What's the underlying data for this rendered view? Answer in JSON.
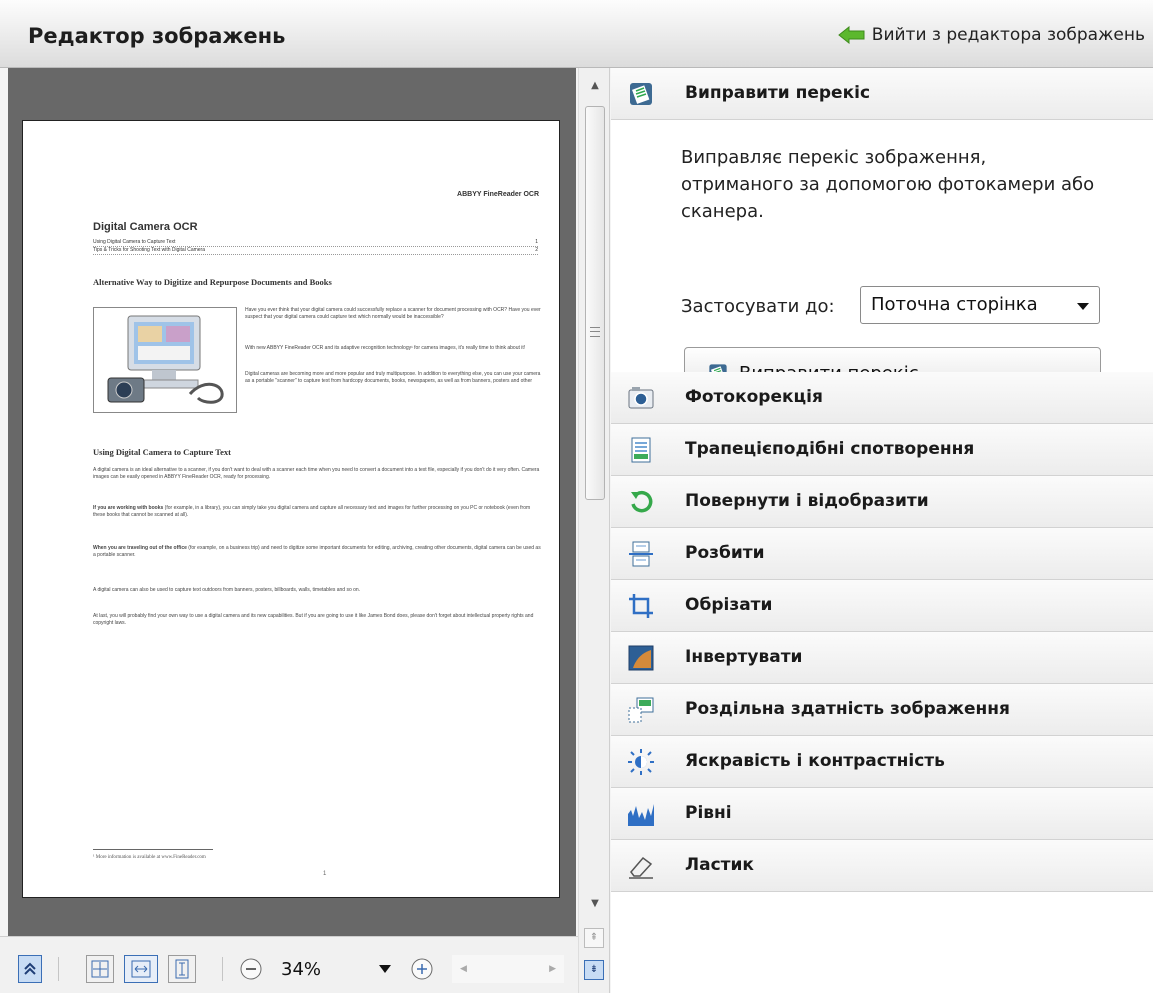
{
  "header": {
    "title": "Редактор зображень",
    "exit_label": "Вийти з редактора зображень"
  },
  "document": {
    "brand": "ABBYY FineReader OCR",
    "title": "Digital Camera OCR",
    "toc": [
      {
        "text": "Using Digital Camera to Capture Text",
        "page": "1"
      },
      {
        "text": "Tips & Tricks for Shooting Text with Digital Camera",
        "page": "2"
      }
    ],
    "h2_1": "Alternative Way to Digitize and Repurpose Documents and Books",
    "p1": "Have you ever think that your digital camera could successfully replace a scanner for document processing with OCR? Have you ever suspect that your digital camera could capture text which normally would be inaccessible?",
    "p2": "With new ABBYY FineReader OCR and its adaptive recognition technology¹ for camera images, it's really time to think about it!",
    "p3": "Digital cameras are becoming more and more popular and truly multipurpose. In addition to everything else, you can use your camera as a portable \"scanner\" to capture text from hardcopy documents, books, newspapers, as well as from banners, posters and other media. Then, with ABBYY FineReader OCR, you can convert your camera images into electronic text files for editing, archiving, creating new documents and for other purposes.",
    "h2_2": "Using Digital Camera to Capture Text",
    "p4": "A digital camera is an ideal alternative to a scanner, if you don't want to deal with a scanner each time when you need to convert a document into a text file, especially if you don't do it very often. Camera images can be easily opened in ABBYY FineReader OCR, ready for processing.",
    "p5_bold": "If you are working with books",
    "p5": " (for example, in a library), you can simply take you digital camera and capture all necessary text and images for further processing on you PC or notebook (even from these books that cannot be scanned at all).",
    "p6_bold": "When you are traveling out of the office",
    "p6": " (for example, on a business trip) and need to digitize some important documents for editing, archiving, creating other documents, digital camera can be used as a portable scanner.",
    "p7": "A digital camera can also be used to capture text outdoors from banners, posters, billboards, walls, timetables and so on.",
    "p8": "At last, you will probably find your own way to use a digital camera and its new capabilities. But if you are going to use it like James Bond does, please don't forget about intellectual property rights and copyright laws.",
    "footnote": "¹ More information is available at www.FineReader.com",
    "page_number": "1"
  },
  "zoom": {
    "value": "34%"
  },
  "panel": {
    "expanded": {
      "label": "Виправити перекіс",
      "description": "Виправляє перекіс зображення, отриманого за допомогою фотокамери або сканера.",
      "apply_label": "Застосувати до:",
      "apply_value": "Поточна сторінка",
      "button_label": "Виправити перекіс"
    },
    "tools": [
      {
        "label": "Фотокорекція",
        "icon": "camera-icon"
      },
      {
        "label": "Трапецієподібні спотворення",
        "icon": "trapezoid-icon"
      },
      {
        "label": "Повернути і відобразити",
        "icon": "rotate-icon"
      },
      {
        "label": "Розбити",
        "icon": "split-icon"
      },
      {
        "label": "Обрізати",
        "icon": "crop-icon"
      },
      {
        "label": "Інвертувати",
        "icon": "invert-icon"
      },
      {
        "label": "Роздільна здатність зображення",
        "icon": "resolution-icon"
      },
      {
        "label": "Яскравість і контрастність",
        "icon": "brightness-icon"
      },
      {
        "label": "Рівні",
        "icon": "levels-icon"
      },
      {
        "label": "Ластик",
        "icon": "eraser-icon"
      }
    ]
  }
}
